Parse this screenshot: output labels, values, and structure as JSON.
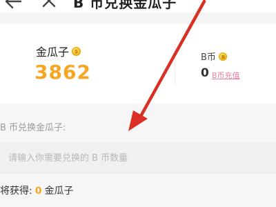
{
  "header": {
    "title": "B 币兑换金瓜子"
  },
  "balance": {
    "gold_label": "金瓜子",
    "gold_value": "3862",
    "bcoin_label": "B币",
    "bcoin_value": "0",
    "recharge_label": "B币充值"
  },
  "exchange": {
    "section_title": "B 币兑换金瓜子:",
    "input_placeholder": "请输入你需要兑换的 B 币数量",
    "input_value": "",
    "result_prefix": "将获得:",
    "result_value": "0",
    "result_unit": "金瓜子"
  },
  "icons": {
    "back": "back-arrow-icon",
    "close": "close-icon",
    "gold_coin": "gold-seed-coin-icon",
    "bcoin": "b-coin-icon"
  },
  "colors": {
    "gold_accent": "#f5a623",
    "recharge_link": "#e7829b",
    "annotation_arrow": "#d93025"
  }
}
